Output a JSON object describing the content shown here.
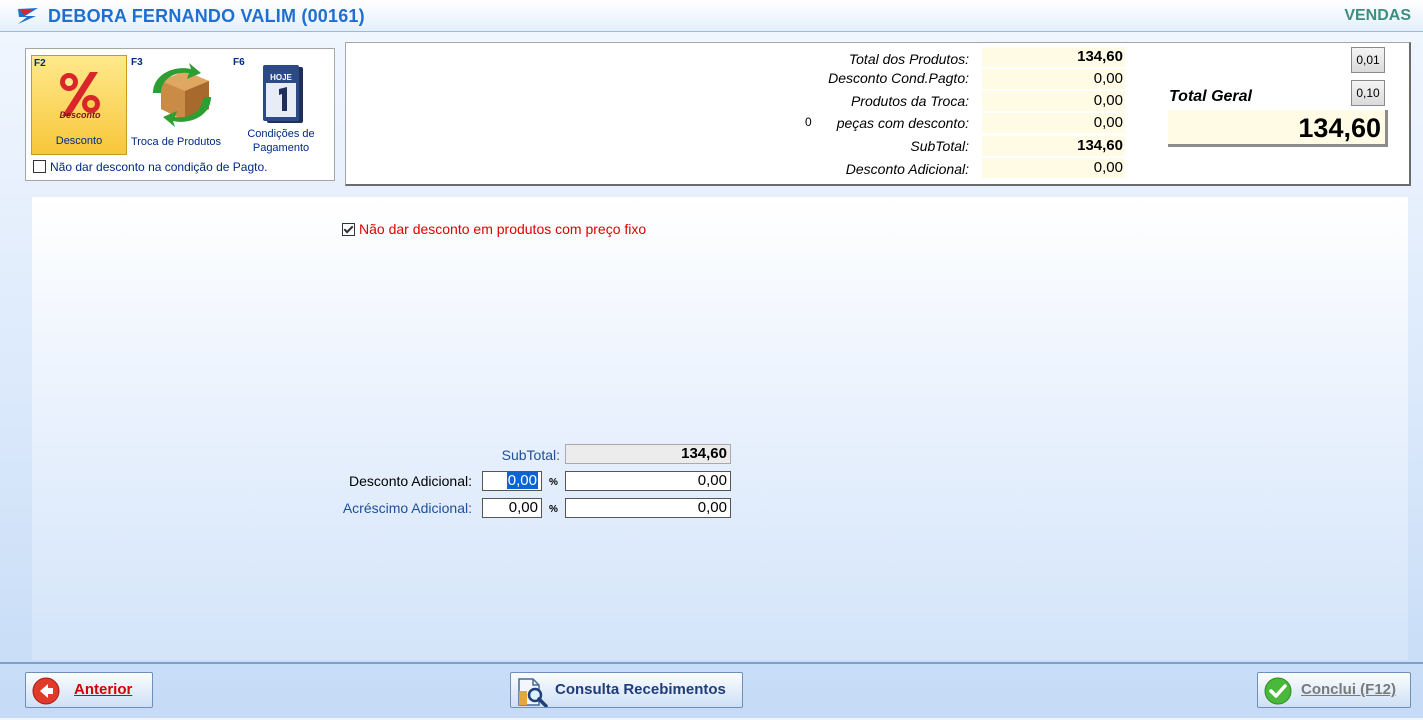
{
  "window": {
    "title": "DEBORA FERNANDO VALIM (00161)",
    "section": "VENDAS"
  },
  "functions": {
    "desconto": {
      "key": "F2",
      "label": "Desconto",
      "icon_text": "Desconto"
    },
    "troca": {
      "key": "F3",
      "label": "Troca de Produtos"
    },
    "condicoes": {
      "key": "F6",
      "label_line1": "Condições de",
      "label_line2": "Pagamento",
      "icon_text": "HOJE"
    },
    "no_discount_condition": {
      "label": "Não dar desconto na condição de Pagto.",
      "checked": false
    }
  },
  "totals": {
    "total_produtos": {
      "label": "Total dos Produtos:",
      "value": "134,60"
    },
    "desconto_cond": {
      "label": "Desconto Cond.Pagto:",
      "value": "0,00"
    },
    "produtos_troca": {
      "label": "Produtos da Troca:",
      "value": "0,00"
    },
    "pecas_desconto": {
      "count": "0",
      "label": "peças com desconto:",
      "value": "0,00"
    },
    "subtotal": {
      "label": "SubTotal:",
      "value": "134,60"
    },
    "desconto_adicional": {
      "label": "Desconto Adicional:",
      "value": "0,00"
    },
    "total_geral": {
      "label": "Total Geral",
      "value": "134,60"
    },
    "round_001": "0,01",
    "round_010": "0,10"
  },
  "main": {
    "fixed_price_checkbox": {
      "label": "Não dar desconto em produtos com preço fixo",
      "checked": true
    },
    "subtotal": {
      "label": "SubTotal:",
      "value": "134,60"
    },
    "desconto": {
      "label": "Desconto Adicional:",
      "percent": "0,00",
      "percent_sign": "%",
      "value": "0,00"
    },
    "acrescimo": {
      "label": "Acréscimo Adicional:",
      "percent": "0,00",
      "percent_sign": "%",
      "value": "0,00"
    }
  },
  "buttons": {
    "anterior": "Anterior",
    "consulta": "Consulta Recebimentos",
    "conclui": "Conclui (F12)"
  },
  "colors": {
    "title": "#1f6fd1",
    "section": "#3b8f7e",
    "warning": "#e00000",
    "label_blue": "#002a86"
  }
}
